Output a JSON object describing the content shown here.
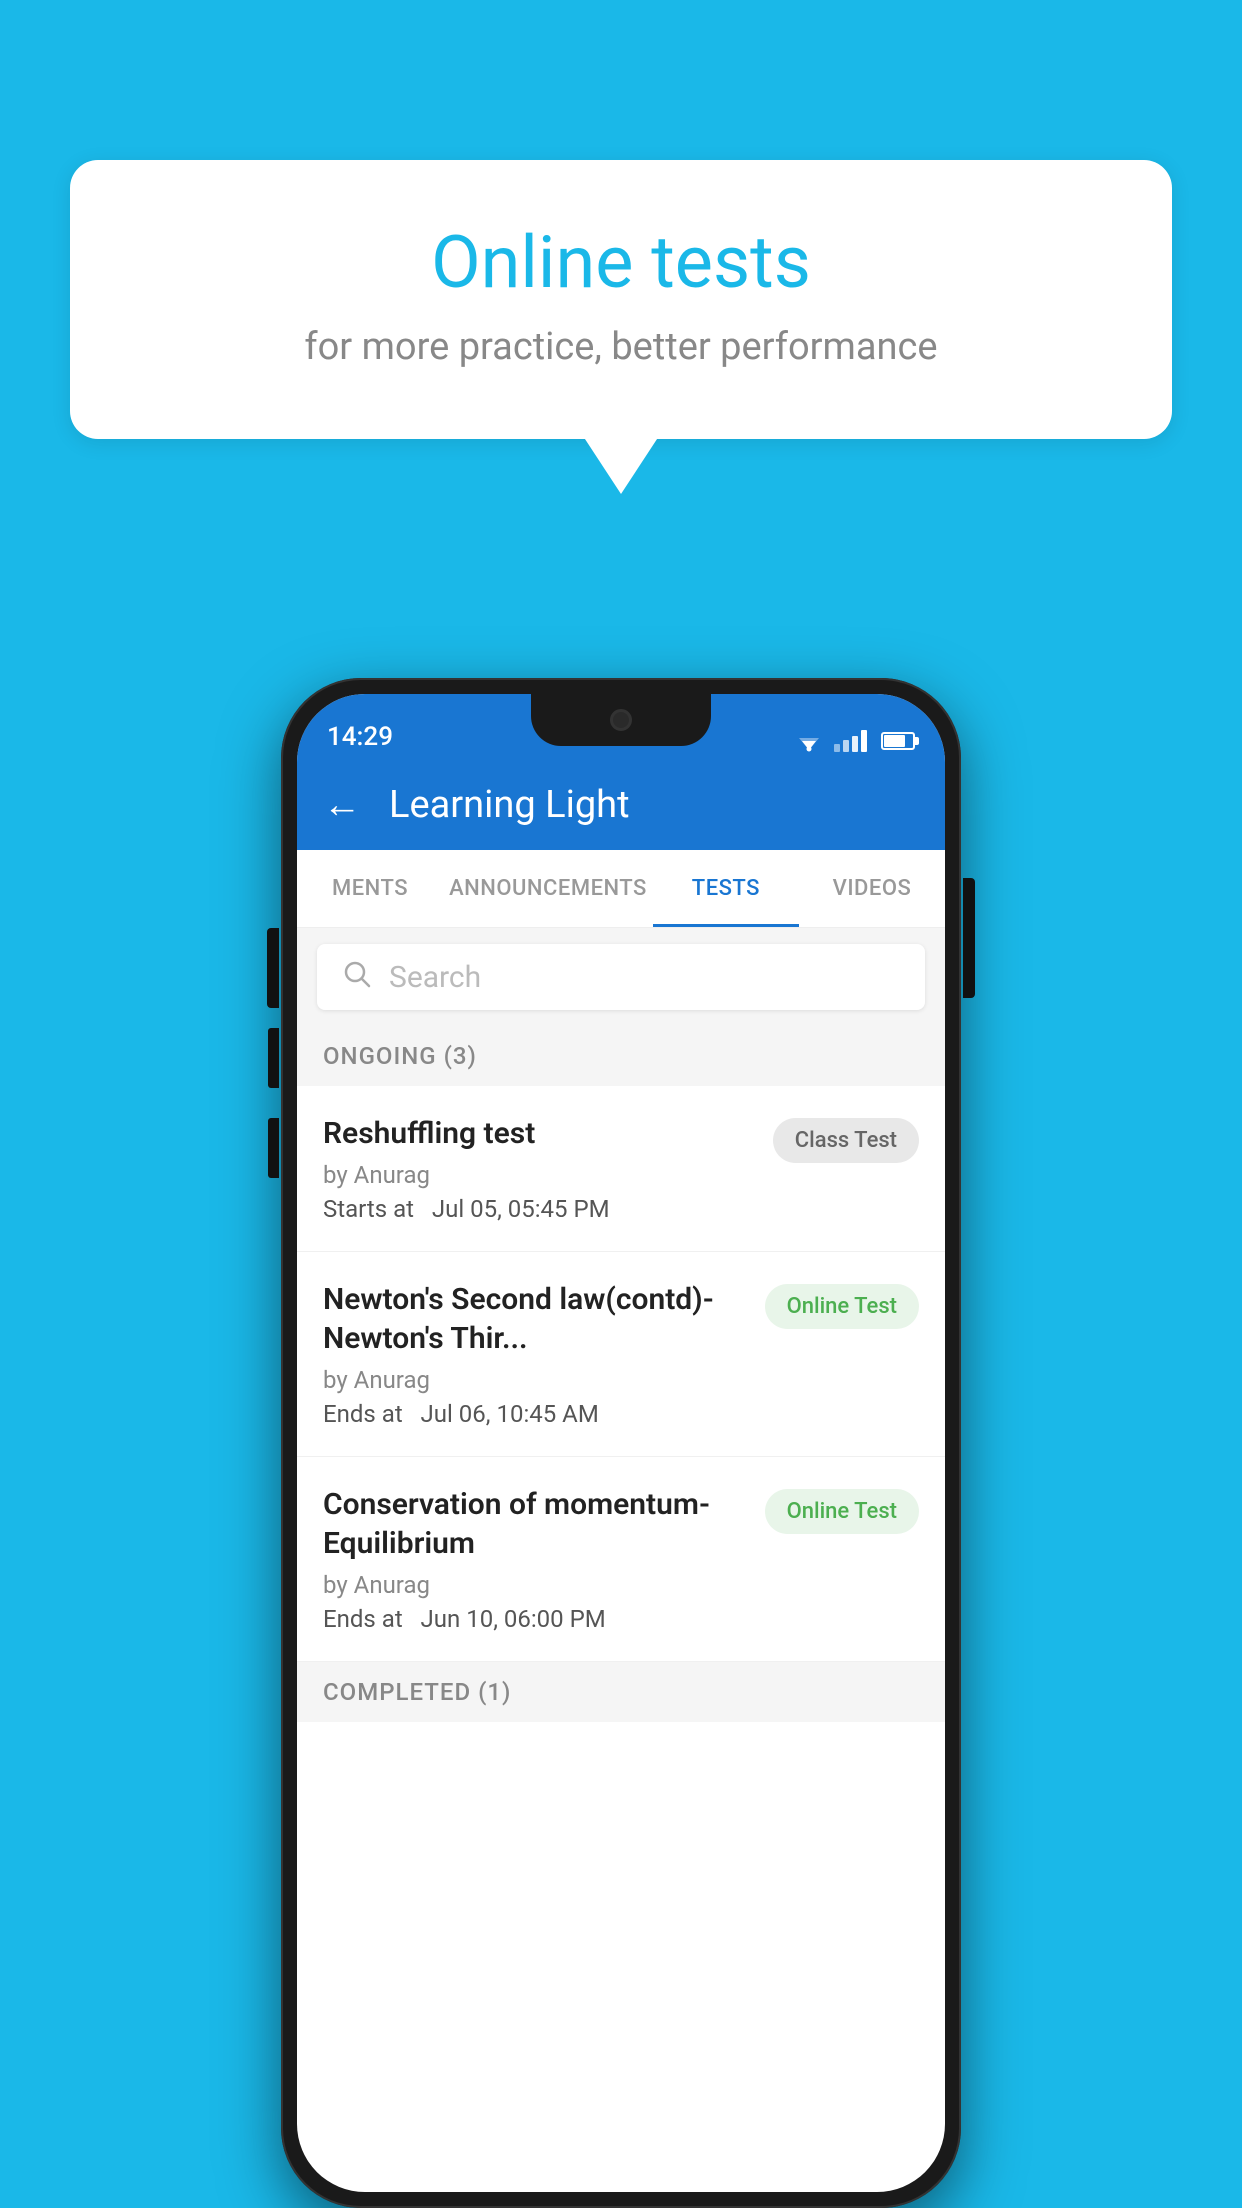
{
  "background_color": "#1ab8e8",
  "speech_bubble": {
    "title": "Online tests",
    "subtitle": "for more practice, better performance"
  },
  "phone": {
    "status_bar": {
      "time": "14:29"
    },
    "header": {
      "title": "Learning Light",
      "back_label": "←"
    },
    "tabs": [
      {
        "label": "MENTS",
        "active": false
      },
      {
        "label": "ANNOUNCEMENTS",
        "active": false
      },
      {
        "label": "TESTS",
        "active": true
      },
      {
        "label": "VIDEOS",
        "active": false
      }
    ],
    "search": {
      "placeholder": "Search"
    },
    "ongoing_section": {
      "title": "ONGOING (3)"
    },
    "test_items": [
      {
        "name": "Reshuffling test",
        "author": "by Anurag",
        "date_label": "Starts at",
        "date_value": "Jul 05, 05:45 PM",
        "badge": "Class Test",
        "badge_type": "class"
      },
      {
        "name": "Newton's Second law(contd)-Newton's Thir...",
        "author": "by Anurag",
        "date_label": "Ends at",
        "date_value": "Jul 06, 10:45 AM",
        "badge": "Online Test",
        "badge_type": "online"
      },
      {
        "name": "Conservation of momentum-Equilibrium",
        "author": "by Anurag",
        "date_label": "Ends at",
        "date_value": "Jun 10, 06:00 PM",
        "badge": "Online Test",
        "badge_type": "online"
      }
    ],
    "completed_section": {
      "title": "COMPLETED (1)"
    }
  }
}
